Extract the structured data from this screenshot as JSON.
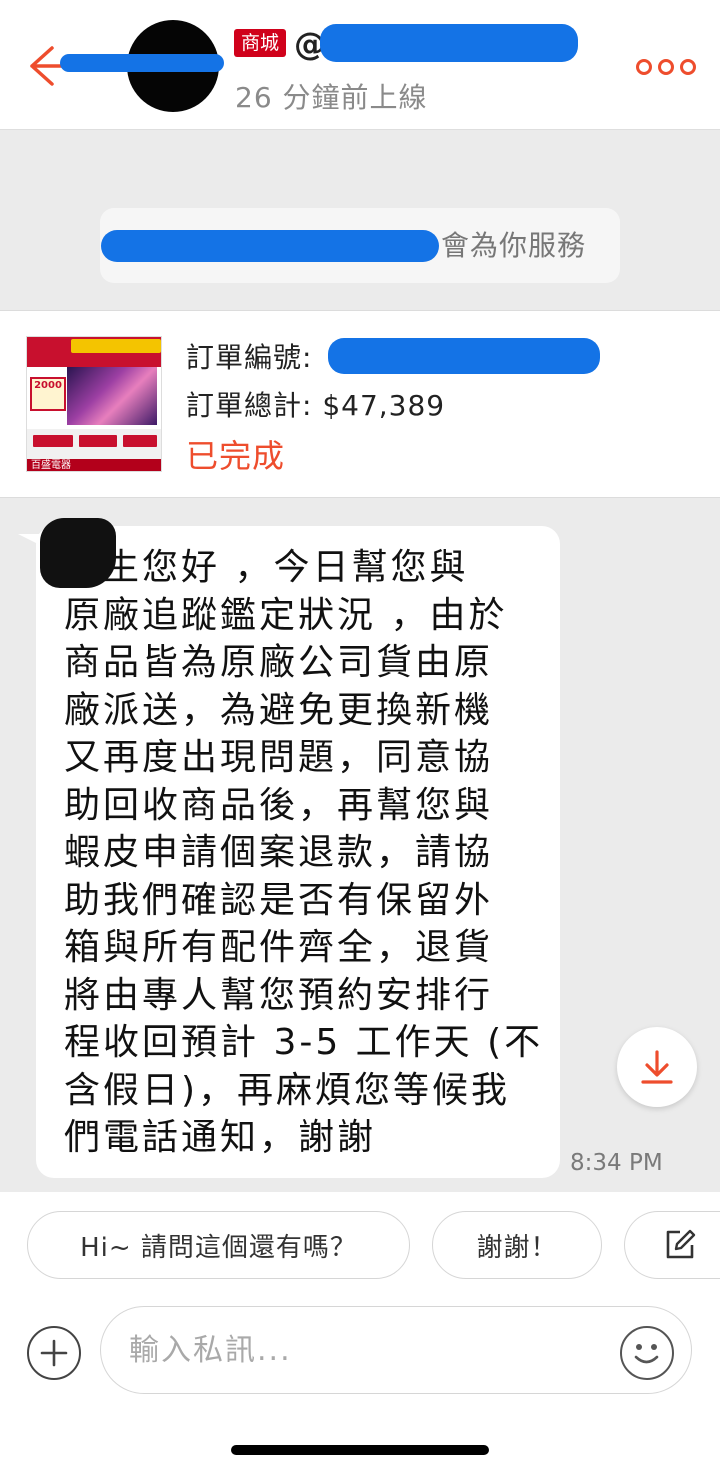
{
  "header": {
    "mall_badge": "商城",
    "at_sign": "@",
    "last_seen": "26 分鐘前上線",
    "icons": {
      "back": "arrow-left-icon",
      "more": "more-dots-icon"
    }
  },
  "notice": {
    "text": "會為你服務"
  },
  "order": {
    "number_label": "訂單編號:",
    "total_label": "訂單總計: $47,389",
    "status": "已完成",
    "thumb_badge": "2000",
    "thumb_footer": "百盛電器"
  },
  "message": {
    "lines": [
      "先生您好 ，今日幫您與",
      "原廠追蹤鑑定狀況 ，由於",
      "商品皆為原廠公司貨由原",
      "廠派送，為避免更換新機",
      "又再度出現問題，同意協",
      "助回收商品後，再幫您與",
      "蝦皮申請個案退款，請協",
      "助我們確認是否有保留外",
      "箱與所有配件齊全，退貨",
      "將由專人幫您預約安排行",
      "程收回預計 3-5 工作天 (不",
      "含假日)，再麻煩您等候我",
      "們電話通知，謝謝"
    ],
    "time": "8:34 PM"
  },
  "quick_replies": [
    "Hi~ 請問這個還有嗎？",
    "謝謝！"
  ],
  "composer": {
    "placeholder": "輸入私訊...",
    "icons": {
      "plus": "plus-icon",
      "emoji": "emoji-icon",
      "edit": "edit-icon",
      "download": "download-icon"
    }
  },
  "colors": {
    "accent": "#ee4d2d",
    "mall_badge": "#d0011b",
    "redaction": "#1473e6"
  }
}
